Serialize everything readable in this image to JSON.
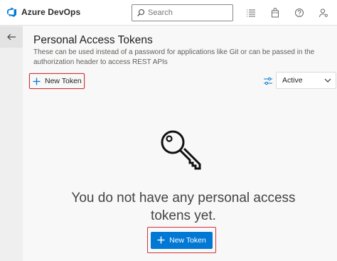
{
  "app": {
    "name": "Azure DevOps"
  },
  "search": {
    "placeholder": "Search"
  },
  "header_icons": [
    "list-icon",
    "shopping-bag-icon",
    "help-icon",
    "user-settings-icon"
  ],
  "page": {
    "title": "Personal Access Tokens",
    "description": "These can be used instead of a password for applications like Git or can be passed in the authorization header to access REST APIs"
  },
  "toolbar": {
    "new_token_label": "New Token",
    "filter_value": "Active"
  },
  "empty_state": {
    "message": "You do not have any personal access tokens yet.",
    "button_label": "New Token"
  },
  "colors": {
    "accent": "#0078d4",
    "highlight": "#d13438"
  }
}
